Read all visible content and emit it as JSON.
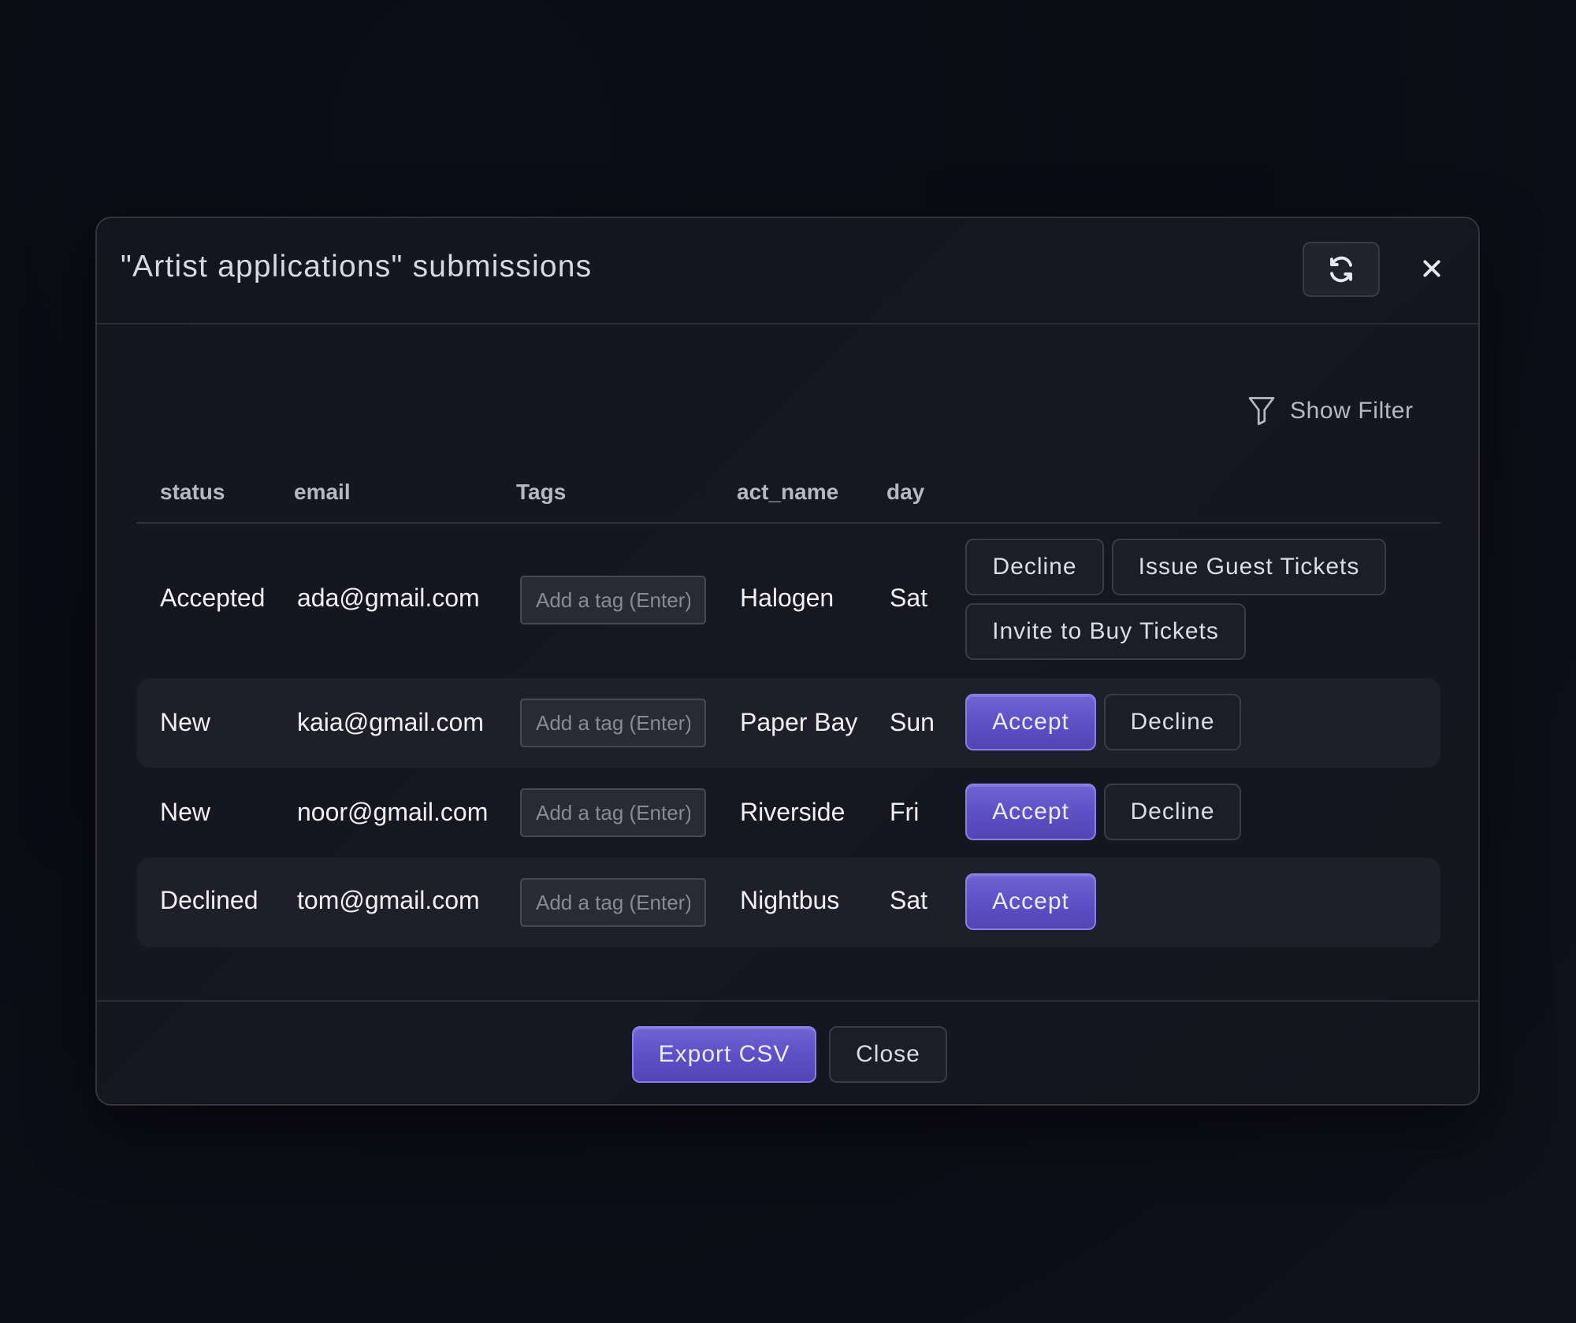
{
  "modal": {
    "title": "\"Artist applications\" submissions",
    "refresh_icon": "refresh-icon",
    "close_icon": "close-icon"
  },
  "filter": {
    "icon": "funnel-icon",
    "label": "Show Filter"
  },
  "table": {
    "columns": [
      "status",
      "email",
      "Tags",
      "act_name",
      "day"
    ],
    "tag_placeholder": "Add a tag (Enter)",
    "rows": [
      {
        "status": "Accepted",
        "email": "ada@gmail.com",
        "act_name": "Halogen",
        "day": "Sat",
        "actions": [
          "Decline",
          "Issue Guest Tickets",
          "Invite to Buy Tickets"
        ]
      },
      {
        "status": "New",
        "email": "kaia@gmail.com",
        "act_name": "Paper Bay",
        "day": "Sun",
        "actions": [
          "Accept",
          "Decline"
        ]
      },
      {
        "status": "New",
        "email": "noor@gmail.com",
        "act_name": "Riverside",
        "day": "Fri",
        "actions": [
          "Accept",
          "Decline"
        ]
      },
      {
        "status": "Declined",
        "email": "tom@gmail.com",
        "act_name": "Nightbus",
        "day": "Sat",
        "actions": [
          "Accept"
        ]
      }
    ]
  },
  "footer": {
    "export_label": "Export CSV",
    "close_label": "Close"
  },
  "colors": {
    "accent": "#6356cc",
    "background": "#0c0c15",
    "panel": "#161620"
  }
}
